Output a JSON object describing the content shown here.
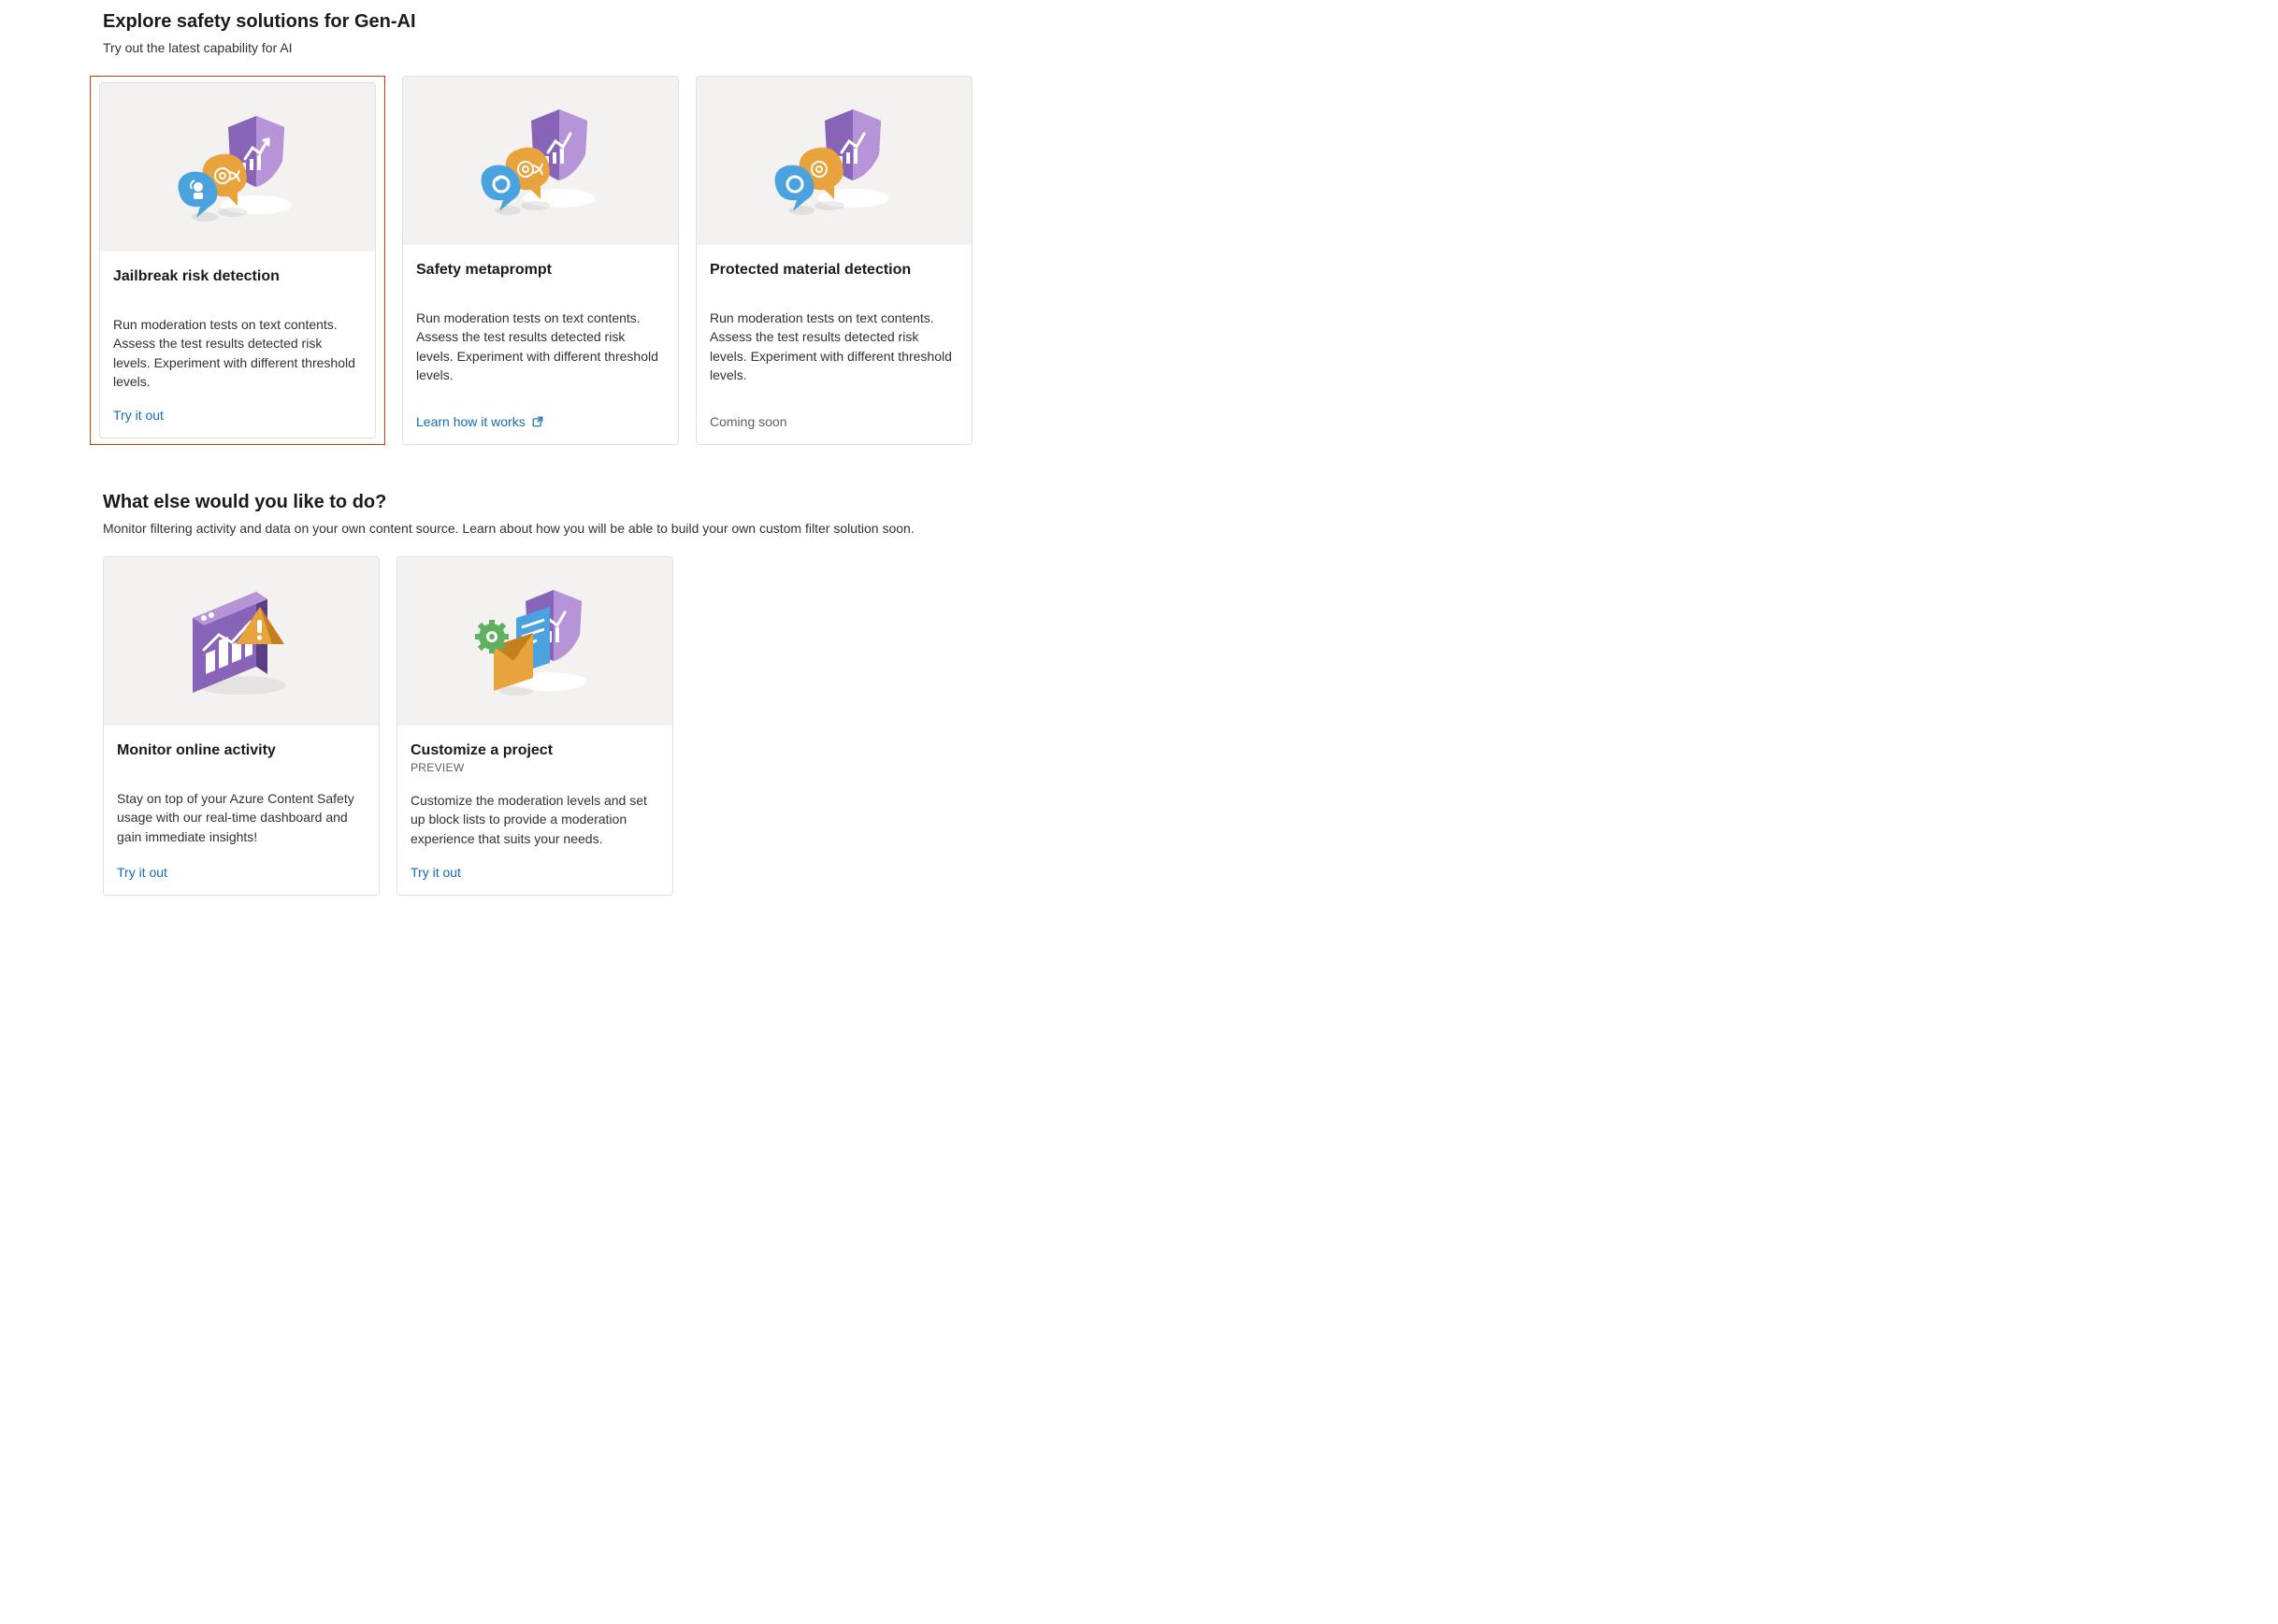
{
  "colors": {
    "link": "#0f6cbd",
    "muted": "#605e5c",
    "highlight": "#d83b01",
    "purple": "#8764b8",
    "purpleLight": "#b794d8",
    "orange": "#e8a33d",
    "orangeDark": "#c57f1f",
    "blue": "#4aa3df",
    "blueDark": "#2b7fbf",
    "green": "#5fb05f"
  },
  "section1": {
    "title": "Explore safety solutions for Gen-AI",
    "subtitle": "Try out the latest capability for AI",
    "cards": [
      {
        "title": "Jailbreak risk detection",
        "desc": "Run moderation tests on text contents. Assess the test results detected risk levels. Experiment with different threshold levels.",
        "actionLabel": "Try it out",
        "actionKind": "link"
      },
      {
        "title": "Safety metaprompt",
        "desc": "Run moderation tests on text contents. Assess the test results detected risk levels. Experiment with different threshold levels.",
        "actionLabel": "Learn how it works",
        "actionKind": "external"
      },
      {
        "title": "Protected material detection",
        "desc": "Run moderation tests on text contents. Assess the test results detected risk levels. Experiment with different threshold levels.",
        "actionLabel": "Coming soon",
        "actionKind": "disabled"
      }
    ]
  },
  "section2": {
    "title": "What else would you like to do?",
    "subtitle": "Monitor filtering activity and data on your own content source. Learn about how you will be able to build your own custom filter solution soon.",
    "cards": [
      {
        "title": "Monitor online activity",
        "desc": "Stay on top of your Azure Content Safety usage with our real-time dashboard and gain immediate insights!",
        "actionLabel": "Try it out"
      },
      {
        "title": "Customize a project",
        "badge": "PREVIEW",
        "desc": "Customize the moderation levels and set up block lists to provide a moderation experience that suits your needs.",
        "actionLabel": "Try it out"
      }
    ]
  }
}
